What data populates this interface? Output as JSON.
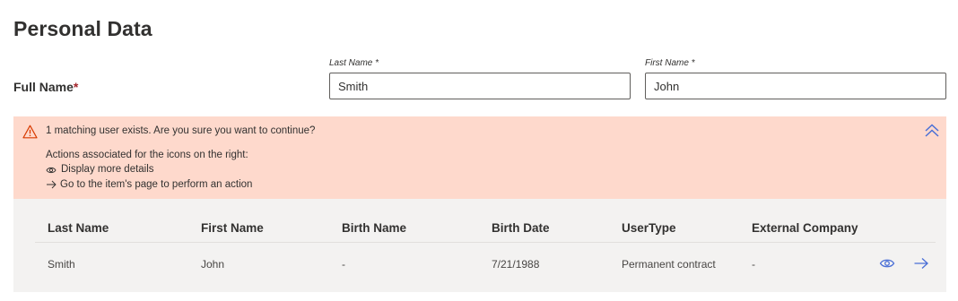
{
  "section_title": "Personal Data",
  "full_name": {
    "label": "Full Name",
    "required_marker": "*",
    "last_name": {
      "label": "Last Name *",
      "value": "Smith"
    },
    "first_name": {
      "label": "First Name *",
      "value": "John"
    }
  },
  "warning": {
    "title": "1 matching user exists. Are you sure you want to continue?",
    "intro": "Actions associated for the icons on the right:",
    "eye_action": "Display more details",
    "arrow_action": "Go to the item's page to perform an action",
    "icon": "warning-triangle-icon",
    "background": "#fed9cc"
  },
  "table": {
    "columns": [
      "Last Name",
      "First Name",
      "Birth Name",
      "Birth Date",
      "UserType",
      "External Company"
    ],
    "rows": [
      [
        "Smith",
        "John",
        "-",
        "7/21/1988",
        "Permanent contract",
        "-"
      ]
    ]
  },
  "colors": {
    "accent": "#4a6fd6",
    "required": "#a4262c",
    "warning_icon": "#d83b01"
  }
}
